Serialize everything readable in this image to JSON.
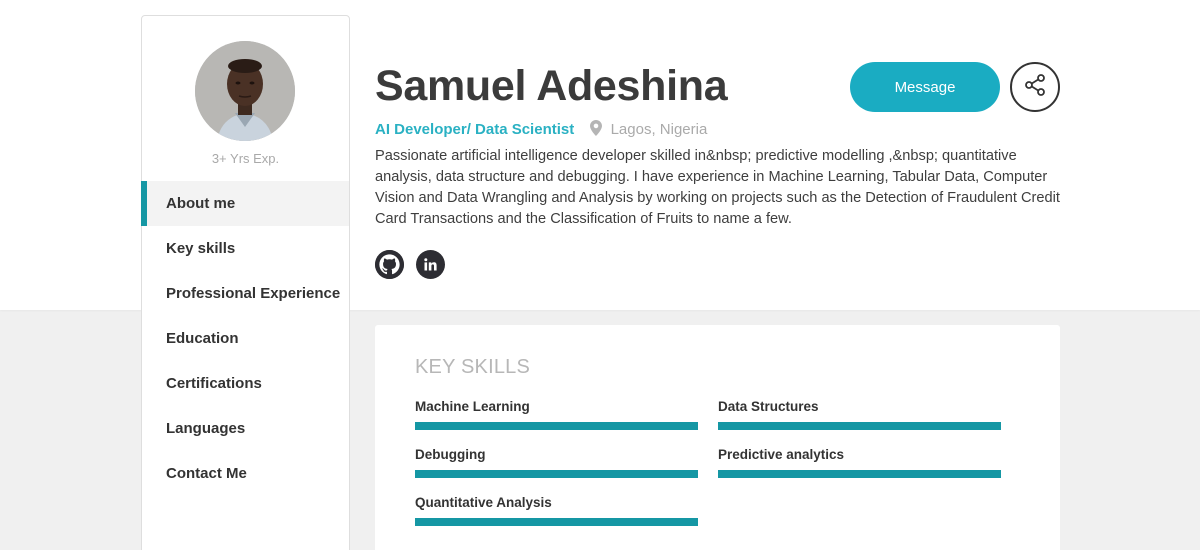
{
  "profile": {
    "name": "Samuel Adeshina",
    "role": "AI Developer/ Data Scientist",
    "location": "Lagos, Nigeria",
    "experience": "3+ Yrs Exp.",
    "bio": "Passionate artificial intelligence developer skilled in&nbsp; predictive modelling ,&nbsp; quantitative analysis, data structure and debugging. I have experience in Machine Learning, Tabular Data, Computer Vision and Data Wrangling and Analysis by working on projects such as the Detection of Fraudulent Credit Card Transactions and the Classification of Fruits to name a few."
  },
  "actions": {
    "message_label": "Message",
    "share_icon": "share-icon"
  },
  "social": [
    {
      "icon": "github-icon"
    },
    {
      "icon": "linkedin-icon"
    }
  ],
  "sidebar": {
    "items": [
      {
        "label": "About me",
        "active": true
      },
      {
        "label": "Key skills"
      },
      {
        "label": "Professional Experience"
      },
      {
        "label": "Education"
      },
      {
        "label": "Certifications"
      },
      {
        "label": "Languages"
      },
      {
        "label": "Contact Me"
      }
    ]
  },
  "skills_card": {
    "heading": "KEY SKILLS",
    "skills": [
      {
        "name": "Machine Learning",
        "level": 1.0
      },
      {
        "name": "Data Structures",
        "level": 1.0
      },
      {
        "name": "Debugging",
        "level": 1.0
      },
      {
        "name": "Predictive analytics",
        "level": 1.0
      },
      {
        "name": "Quantitative Analysis",
        "level": 1.0
      }
    ]
  },
  "colors": {
    "accent": "#1597a4",
    "button": "#1aacc2",
    "role_text": "#2ab1c3"
  }
}
